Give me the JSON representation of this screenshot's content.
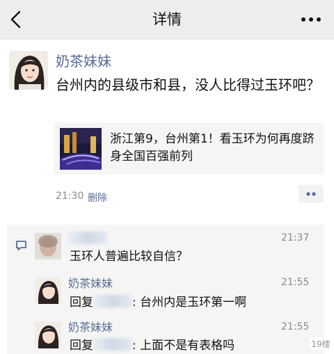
{
  "nav": {
    "title": "详情"
  },
  "post": {
    "author": "奶茶妹妹",
    "text": "台州内的县级市和县，没人比得过玉环吧？",
    "link": {
      "title": "浙江第9，台州第1！看玉环为何再度跻身全国百强前列"
    },
    "time": "21:30",
    "delete_label": "删除"
  },
  "comments": [
    {
      "time": "21:37",
      "text": "玉环人普遍比较自信？"
    },
    {
      "author": "奶茶妹妹",
      "time": "21:55",
      "reply_prefix": "回复",
      "text": ": 台州内是玉环第一啊"
    },
    {
      "author": "奶茶妹妹",
      "time": "21:55",
      "reply_prefix": "回复",
      "text": ": 上面不是有表格吗"
    }
  ],
  "watermark": "19楼",
  "colors": {
    "nav_bg": "#ededed",
    "link": "#576b95",
    "comment_bg": "#f5f5f5"
  },
  "icons": [
    "back-arrow-icon",
    "more-dots-icon",
    "action-dots-icon",
    "comment-bubble-icon"
  ]
}
